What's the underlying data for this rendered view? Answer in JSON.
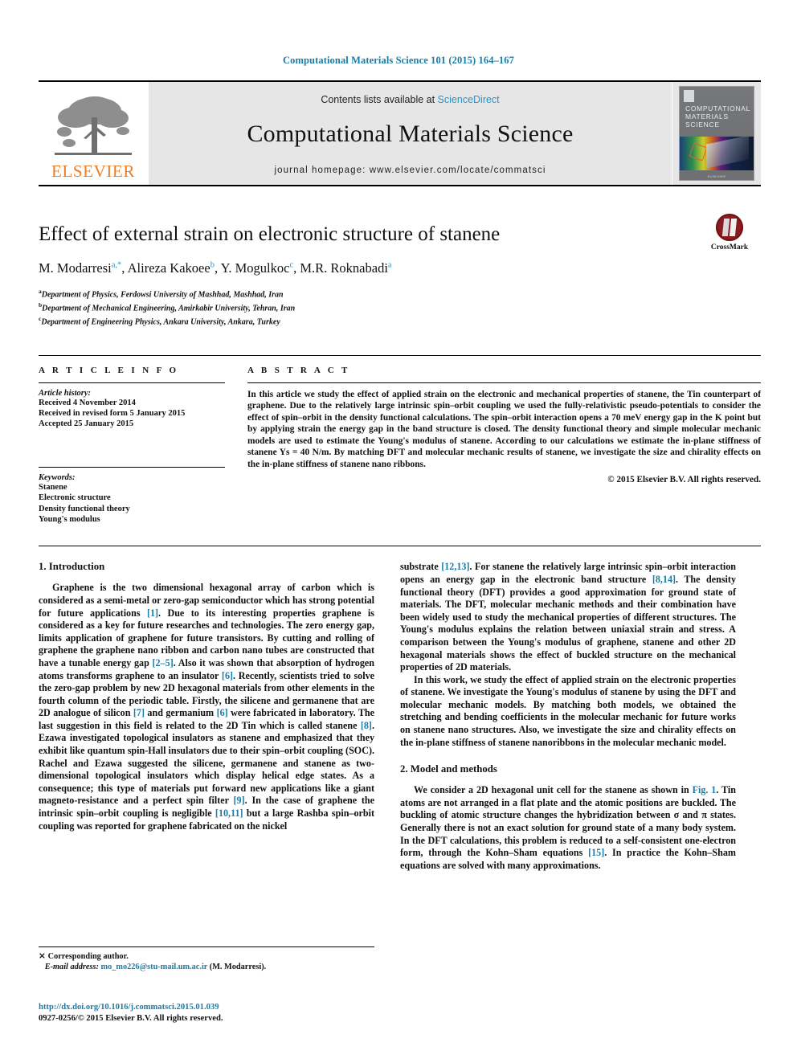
{
  "running_head": "Computational Materials Science 101 (2015) 164–167",
  "masthead": {
    "publisher_logo_text": "ELSEVIER",
    "contents_prefix": "Contents lists available at ",
    "contents_link": "ScienceDirect",
    "journal_title": "Computational Materials Science",
    "homepage": "journal homepage: www.elsevier.com/locate/commatsci",
    "cover": {
      "line1": "COMPUTATIONAL",
      "line2": "MATERIALS",
      "line3": "SCIENCE",
      "footer": "ELSEVIER"
    }
  },
  "article": {
    "title": "Effect of external strain on electronic structure of stanene",
    "authors": [
      {
        "name": "M. Modarresi",
        "marks": "a,*"
      },
      {
        "name": "Alireza Kakoee",
        "marks": "b"
      },
      {
        "name": "Y. Mogulkoc",
        "marks": "c"
      },
      {
        "name": "M.R. Roknabadi",
        "marks": "a"
      }
    ],
    "affiliations": [
      {
        "mark": "a",
        "text": "Department of Physics, Ferdowsi University of Mashhad, Mashhad, Iran"
      },
      {
        "mark": "b",
        "text": "Department of Mechanical Engineering, Amirkabir University, Tehran, Iran"
      },
      {
        "mark": "c",
        "text": "Department of Engineering Physics, Ankara University, Ankara, Turkey"
      }
    ],
    "crossmark_label": "CrossMark"
  },
  "info": {
    "heading": "A R T I C L E    I N F O",
    "history_label": "Article history:",
    "history": [
      "Received 4 November 2014",
      "Received in revised form 5 January 2015",
      "Accepted 25 January 2015"
    ],
    "keywords_label": "Keywords:",
    "keywords": [
      "Stanene",
      "Electronic structure",
      "Density functional theory",
      "Young's modulus"
    ]
  },
  "abstract": {
    "heading": "A B S T R A C T",
    "text": "In this article we study the effect of applied strain on the electronic and mechanical properties of stanene, the Tin counterpart of graphene. Due to the relatively large intrinsic spin–orbit coupling we used the fully-relativistic pseudo-potentials to consider the effect of spin–orbit in the density functional calculations. The spin–orbit interaction opens a 70 meV energy gap in the K point but by applying strain the energy gap in the band structure is closed. The density functional theory and simple molecular mechanic models are used to estimate the Young's modulus of stanene. According to our calculations we estimate the in-plane stiffness of stanene Ys = 40 N/m. By matching DFT and molecular mechanic results of stanene, we investigate the size and chirality effects on the in-plane stiffness of stanene nano ribbons.",
    "copyright": "© 2015 Elsevier B.V. All rights reserved."
  },
  "sections": {
    "intro_title": "1. Introduction",
    "intro_p1_a": "Graphene is the two dimensional hexagonal array of carbon which is considered as a semi-metal or zero-gap semiconductor which has strong potential for future applications ",
    "intro_cite_1": "[1]",
    "intro_p1_b": ". Due to its interesting properties graphene is considered as a key for future researches and technologies. The zero energy gap, limits application of graphene for future transistors. By cutting and rolling of graphene the graphene nano ribbon and carbon nano tubes are constructed that have a tunable energy gap ",
    "intro_cite_2": "[2–5]",
    "intro_p1_c": ". Also it was shown that absorption of hydrogen atoms transforms graphene to an insulator ",
    "intro_cite_3": "[6]",
    "intro_p1_d": ". Recently, scientists tried to solve the zero-gap problem by new 2D hexagonal materials from other elements in the fourth column of the periodic table. Firstly, the silicene and germanene that are 2D analogue of silicon ",
    "intro_cite_4": "[7]",
    "intro_p1_e": " and germanium ",
    "intro_cite_5": "[6]",
    "intro_p1_f": " were fabricated in laboratory. The last suggestion in this field is related to the 2D Tin which is called stanene ",
    "intro_cite_6": "[8]",
    "intro_p1_g": ". Ezawa investigated topological insulators as stanene and emphasized that they exhibit like quantum spin-Hall insulators due to their spin–orbit coupling (SOC). Rachel and Ezawa suggested the silicene, germanene and stanene as two-dimensional topological insulators which display helical edge states. As a consequence; this type of materials put forward new applications like a giant magneto-resistance and a perfect spin filter ",
    "intro_cite_7": "[9]",
    "intro_p1_h": ". In the case of graphene the intrinsic spin–orbit coupling is negligible ",
    "intro_cite_8": "[10,11]",
    "intro_p1_i": " but a large Rashba spin–orbit coupling was reported for graphene fabricated on the nickel",
    "right_p1_a": "substrate ",
    "right_cite_1": "[12,13]",
    "right_p1_b": ". For stanene the relatively large intrinsic spin–orbit interaction opens an energy gap in the electronic band structure ",
    "right_cite_2": "[8,14]",
    "right_p1_c": ". The density functional theory (DFT) provides a good approximation for ground state of materials. The DFT, molecular mechanic methods and their combination have been widely used to study the mechanical properties of different structures. The Young's modulus explains the relation between uniaxial strain and stress. A comparison between the Young's modulus of graphene, stanene and other 2D hexagonal materials shows the effect of buckled structure on the mechanical properties of 2D materials.",
    "right_p2": "In this work, we study the effect of applied strain on the electronic properties of stanene. We investigate the Young's modulus of stanene by using the DFT and molecular mechanic models. By matching both models, we obtained the stretching and bending coefficients in the molecular mechanic for future works on stanene nano structures. Also, we investigate the size and chirality effects on the in-plane stiffness of stanene nanoribbons in the molecular mechanic model.",
    "model_title": "2. Model and methods",
    "model_p1_a": "We consider a 2D hexagonal unit cell for the stanene as shown in ",
    "model_figref": "Fig. 1",
    "model_p1_b": ". Tin atoms are not arranged in a flat plate and the atomic positions are buckled. The buckling of atomic structure changes the hybridization between σ and π states. Generally there is not an exact solution for ground state of a many body system. In the DFT calculations, this problem is reduced to a self-consistent one-electron form, through the Kohn–Sham equations ",
    "model_cite_1": "[15]",
    "model_p1_c": ". In practice the Kohn–Sham equations are solved with many approximations."
  },
  "footer": {
    "corresponding_mark": "⨯",
    "corresponding_text": "Corresponding author.",
    "email_label": "E-mail address:",
    "email": "mo_mo226@stu-mail.um.ac.ir",
    "email_suffix": "(M. Modarresi).",
    "doi": "http://dx.doi.org/10.1016/j.commatsci.2015.01.039",
    "issn": "0927-0256/© 2015 Elsevier B.V. All rights reserved."
  },
  "colors": {
    "link": "#1b7ca5",
    "elsevier_orange": "#ee7c23",
    "sciencedirect": "#2a93c8",
    "crossmark_red": "#8c1b1f"
  }
}
